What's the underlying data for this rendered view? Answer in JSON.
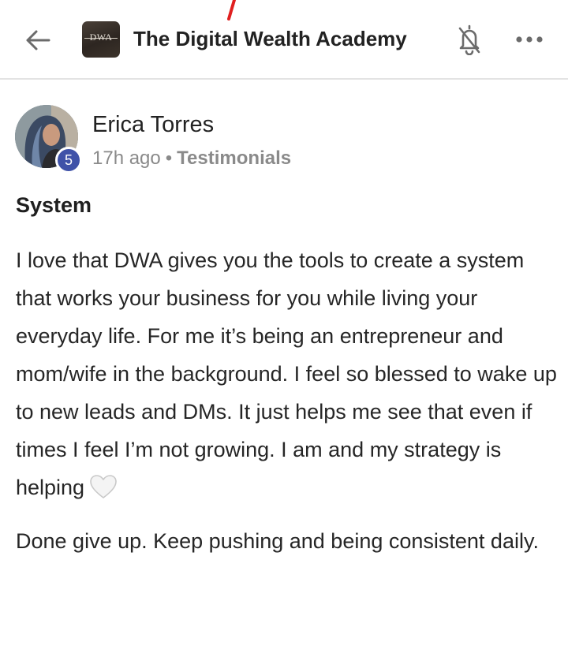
{
  "header": {
    "back_icon": "arrow-left-icon",
    "logo_text": "DWA",
    "group_title": "The Digital Wealth Academy",
    "bell_icon": "bell-off-icon",
    "more_icon": "more-horizontal-icon"
  },
  "post": {
    "author": {
      "name": "Erica Torres",
      "level": "5"
    },
    "time_ago": "17h ago",
    "separator": "•",
    "category": "Testimonials",
    "title": "System",
    "paragraph_1": "I love that DWA gives you the tools to create a system that works your business for you while living your everyday life. For me it’s being an entrepreneur and mom/wife in the background. I feel so blessed to wake up to new leads and DMs. It just helps me see that even if times I feel I’m not growing. I am and my strategy is helping",
    "heart_icon": "white-heart-icon",
    "paragraph_2": "Done give up. Keep pushing and being consistent daily."
  },
  "colors": {
    "badge": "#3f52a8",
    "meta_text": "#8a8a8a",
    "divider": "#e3e3e3"
  }
}
